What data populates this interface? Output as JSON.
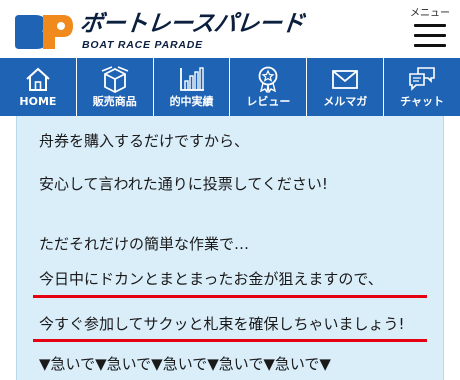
{
  "header": {
    "brand_main": "ボートレースパレード",
    "brand_sub": "BOAT RACE PARADE",
    "menu_label": "メニュー",
    "colors": {
      "logo_blue": "#1e63b4",
      "logo_orange": "#f08a1c",
      "brand_text": "#0b1f3f"
    }
  },
  "nav": {
    "items": [
      {
        "label": "HOME",
        "icon": "home-icon"
      },
      {
        "label": "販売商品",
        "icon": "box-icon"
      },
      {
        "label": "的中実績",
        "icon": "bar-chart-icon"
      },
      {
        "label": "レビュー",
        "icon": "award-badge-icon"
      },
      {
        "label": "メルマガ",
        "icon": "mail-icon"
      },
      {
        "label": "チャット",
        "icon": "chat-icon"
      }
    ],
    "colors": {
      "background": "#1e63b4",
      "text": "#ffffff"
    }
  },
  "content": {
    "lines": [
      "舟券を購入するだけですから、",
      "安心して言われた通りに投票してください!",
      "ただそれだけの簡単な作業で…",
      "今日中にドカンとまとまったお金が狙えますので、",
      "今すぐ参加してサクッと札束を確保しちゃいましょう!",
      "▼急いで▼急いで▼急いで▼急いで▼急いで▼"
    ],
    "colors": {
      "background": "#daeefa",
      "underline": "#e50012"
    }
  }
}
